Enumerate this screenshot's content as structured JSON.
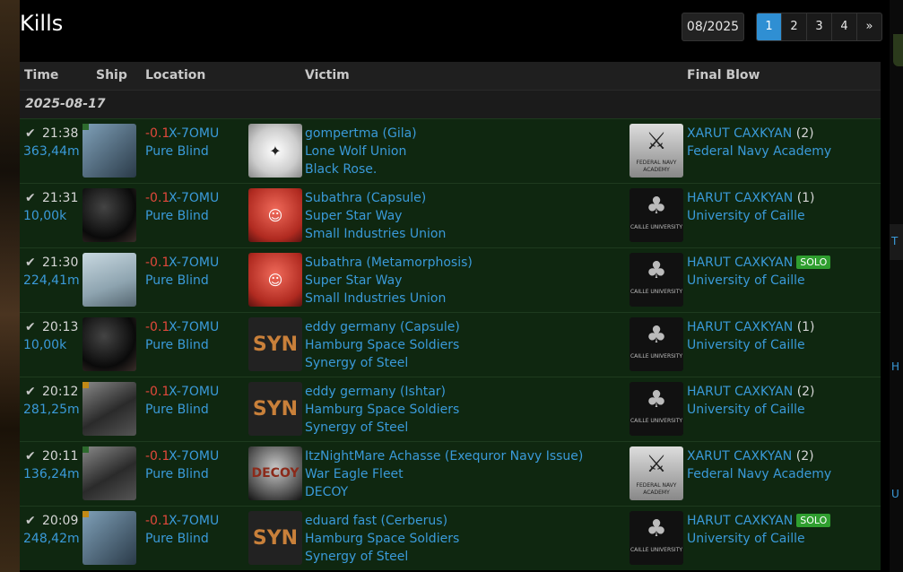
{
  "page": {
    "title": "Kills",
    "month": "08/2025"
  },
  "pagination": [
    {
      "label": "1",
      "active": true
    },
    {
      "label": "2",
      "active": false
    },
    {
      "label": "3",
      "active": false
    },
    {
      "label": "4",
      "active": false
    },
    {
      "label": "»",
      "active": false
    }
  ],
  "columns": {
    "time": "Time",
    "ship": "Ship",
    "location": "Location",
    "victim": "Victim",
    "final_blow": "Final Blow"
  },
  "date": "2025-08-17",
  "side_fragments": [
    "T",
    "H",
    "U"
  ],
  "kills": [
    {
      "time": "21:38",
      "value": "363,44m",
      "ship_img": "gila-ship-icon",
      "ship_tag": "g",
      "ship_tag_icon": "meta-tag-icon",
      "security": "-0.1",
      "system": "X-7OMU",
      "region": "Pure Blind",
      "victim_logo": "black-rose-logo",
      "victim_logo_style": "white",
      "victim_logo_text": "✦",
      "victim": "gompertma",
      "victim_ship": "(Gila)",
      "victim_corp": "Lone Wolf Union",
      "victim_alliance": "Black Rose.",
      "fb_logo": "federal-navy-academy-logo",
      "fb_logo_style": "fna",
      "fb_logo_glyph": "⚔",
      "fb_logo_text": "FEDERAL NAVY ACADEMY",
      "fb_name": "XARUT CAXKYAN",
      "fb_count": "(2)",
      "solo": "",
      "fb_corp": "Federal Navy Academy"
    },
    {
      "time": "21:31",
      "value": "10,00k",
      "ship_img": "capsule-ship-icon",
      "ship_tag": "",
      "ship_tag_icon": "",
      "security": "-0.1",
      "system": "X-7OMU",
      "region": "Pure Blind",
      "victim_logo": "small-industries-logo",
      "victim_logo_style": "red",
      "victim_logo_text": "☺",
      "victim": "Subathra",
      "victim_ship": "(Capsule)",
      "victim_corp": "Super Star Way",
      "victim_alliance": "Small Industries Union",
      "fb_logo": "university-of-caille-logo",
      "fb_logo_style": "caille",
      "fb_logo_glyph": "♣",
      "fb_logo_text": "CAILLE UNIVERSITY",
      "fb_name": "HARUT CAXKYAN",
      "fb_count": "(1)",
      "solo": "",
      "fb_corp": "University of Caille"
    },
    {
      "time": "21:30",
      "value": "224,41m",
      "ship_img": "metamorphosis-ship-icon",
      "ship_tag": "",
      "ship_tag_icon": "",
      "security": "-0.1",
      "system": "X-7OMU",
      "region": "Pure Blind",
      "victim_logo": "small-industries-logo",
      "victim_logo_style": "red",
      "victim_logo_text": "☺",
      "victim": "Subathra",
      "victim_ship": "(Metamorphosis)",
      "victim_corp": "Super Star Way",
      "victim_alliance": "Small Industries Union",
      "fb_logo": "university-of-caille-logo",
      "fb_logo_style": "caille",
      "fb_logo_glyph": "♣",
      "fb_logo_text": "CAILLE UNIVERSITY",
      "fb_name": "HARUT CAXKYAN",
      "fb_count": "",
      "solo": "SOLO",
      "fb_corp": "University of Caille"
    },
    {
      "time": "20:13",
      "value": "10,00k",
      "ship_img": "capsule-ship-icon",
      "ship_tag": "",
      "ship_tag_icon": "",
      "security": "-0.1",
      "system": "X-7OMU",
      "region": "Pure Blind",
      "victim_logo": "synergy-of-steel-logo",
      "victim_logo_style": "syn",
      "victim_logo_text": "SYN",
      "victim": "eddy germany",
      "victim_ship": "(Capsule)",
      "victim_corp": "Hamburg Space Soldiers",
      "victim_alliance": "Synergy of Steel",
      "fb_logo": "university-of-caille-logo",
      "fb_logo_style": "caille",
      "fb_logo_glyph": "♣",
      "fb_logo_text": "CAILLE UNIVERSITY",
      "fb_name": "HARUT CAXKYAN",
      "fb_count": "(1)",
      "solo": "",
      "fb_corp": "University of Caille"
    },
    {
      "time": "20:12",
      "value": "281,25m",
      "ship_img": "ishtar-ship-icon",
      "ship_tag": "o",
      "ship_tag_icon": "tech2-tag-icon",
      "security": "-0.1",
      "system": "X-7OMU",
      "region": "Pure Blind",
      "victim_logo": "synergy-of-steel-logo",
      "victim_logo_style": "syn",
      "victim_logo_text": "SYN",
      "victim": "eddy germany",
      "victim_ship": "(Ishtar)",
      "victim_corp": "Hamburg Space Soldiers",
      "victim_alliance": "Synergy of Steel",
      "fb_logo": "university-of-caille-logo",
      "fb_logo_style": "caille",
      "fb_logo_glyph": "♣",
      "fb_logo_text": "CAILLE UNIVERSITY",
      "fb_name": "HARUT CAXKYAN",
      "fb_count": "(2)",
      "solo": "",
      "fb_corp": "University of Caille"
    },
    {
      "time": "20:11",
      "value": "136,24m",
      "ship_img": "exequror-navy-issue-ship-icon",
      "ship_tag": "g",
      "ship_tag_icon": "meta-tag-icon",
      "security": "-0.1",
      "system": "X-7OMU",
      "region": "Pure Blind",
      "victim_logo": "decoy-logo",
      "victim_logo_style": "decoy",
      "victim_logo_text": "DECOY",
      "victim": "ItzNightMare Achasse",
      "victim_ship": "(Exequror Navy Issue)",
      "victim_corp": "War Eagle Fleet",
      "victim_alliance": "DECOY",
      "fb_logo": "federal-navy-academy-logo",
      "fb_logo_style": "fna",
      "fb_logo_glyph": "⚔",
      "fb_logo_text": "FEDERAL NAVY ACADEMY",
      "fb_name": "XARUT CAXKYAN",
      "fb_count": "(2)",
      "solo": "",
      "fb_corp": "Federal Navy Academy"
    },
    {
      "time": "20:09",
      "value": "248,42m",
      "ship_img": "cerberus-ship-icon",
      "ship_tag": "o",
      "ship_tag_icon": "tech2-tag-icon",
      "security": "-0.1",
      "system": "X-7OMU",
      "region": "Pure Blind",
      "victim_logo": "synergy-of-steel-logo",
      "victim_logo_style": "syn",
      "victim_logo_text": "SYN",
      "victim": "eduard fast",
      "victim_ship": "(Cerberus)",
      "victim_corp": "Hamburg Space Soldiers",
      "victim_alliance": "Synergy of Steel",
      "fb_logo": "university-of-caille-logo",
      "fb_logo_style": "caille",
      "fb_logo_glyph": "♣",
      "fb_logo_text": "CAILLE UNIVERSITY",
      "fb_name": "HARUT CAXKYAN",
      "fb_count": "",
      "solo": "SOLO",
      "fb_corp": "University of Caille"
    }
  ]
}
